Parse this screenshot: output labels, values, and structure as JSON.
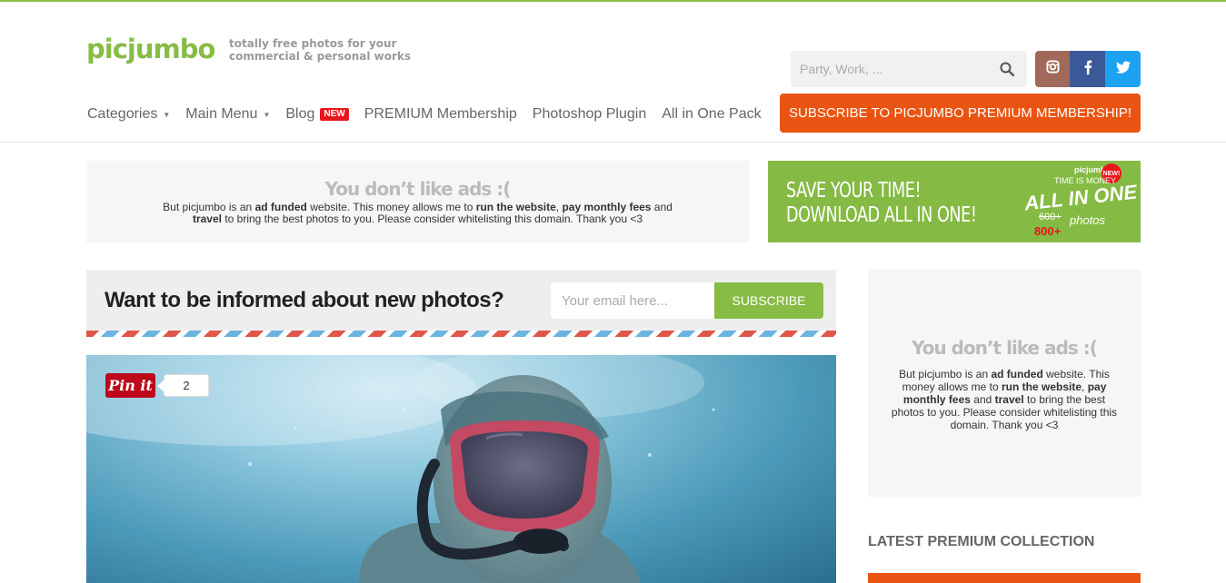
{
  "brand": {
    "logo": "picjumbo",
    "tagline_line1": "totally free photos for your",
    "tagline_line2": "commercial & personal works"
  },
  "search": {
    "placeholder": "Party, Work, ..."
  },
  "social": {
    "instagram": "instagram-icon",
    "facebook": "facebook-icon",
    "twitter": "twitter-icon"
  },
  "nav": {
    "categories": "Categories",
    "main_menu": "Main Menu",
    "blog": "Blog",
    "blog_badge": "NEW",
    "premium": "PREMIUM Membership",
    "photoshop": "Photoshop Plugin",
    "all_in_one": "All in One Pack"
  },
  "subscribe_premium": "SUBSCRIBE TO PICJUMBO PREMIUM MEMBERSHIP!",
  "ad_block": {
    "title": "You don’t like ads :(",
    "t1": "But picjumbo is an ",
    "b1": "ad funded",
    "t2": " website. This money allows me to ",
    "b2": "run the website",
    "t3": ", ",
    "b3": "pay monthly fees",
    "t4": " and ",
    "b4": "travel",
    "t5": " to bring the best photos to you. Please consider whitelisting this domain. Thank you <3"
  },
  "banner": {
    "line1": "SAVE YOUR TIME!",
    "line2": "DOWNLOAD ALL IN ONE!",
    "badge_brand": "picjumbo",
    "badge_sub": "TIME IS MONEY",
    "badge_main": "ALL IN ONE",
    "badge_new": "NEW!",
    "badge_old": "600+",
    "badge_count": "800+",
    "badge_photos": "photos"
  },
  "newsletter": {
    "title": "Want to be informed about new photos?",
    "placeholder": "Your email here...",
    "button": "SUBSCRIBE"
  },
  "photo": {
    "pin_label": "Pin it",
    "pin_count": "2"
  },
  "sidebar": {
    "ad_title": "You don’t like ads :(",
    "latest_title": "LATEST PREMIUM COLLECTION"
  },
  "colors": {
    "brand_green": "#87bc45",
    "accent_orange": "#ea5412",
    "badge_red": "#e8161c"
  }
}
